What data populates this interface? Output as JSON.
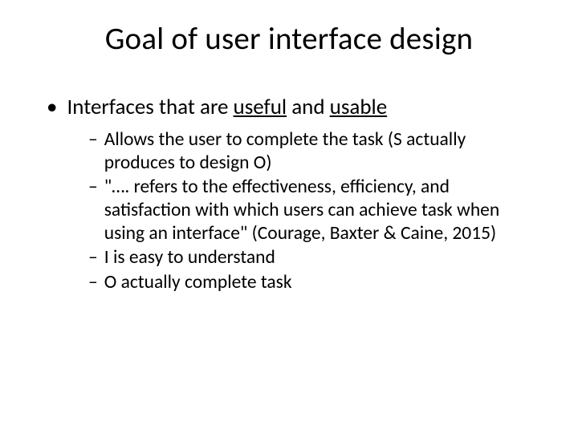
{
  "title": "Goal of user interface design",
  "bullet1": {
    "prefix": "Interfaces that are ",
    "kw1": "useful",
    "mid": " and ",
    "kw2": "usable"
  },
  "sub": {
    "item1": "Allows the user to complete the task (S actually produces to design O)",
    "item2": "\"…. refers to the effectiveness, efficiency, and satisfaction with which users can achieve task when using an interface\" (Courage, Baxter & Caine, 2015)",
    "item3": "I is easy to understand",
    "item4": "O actually complete task"
  },
  "markers": {
    "dot": "•",
    "dash": "–"
  }
}
